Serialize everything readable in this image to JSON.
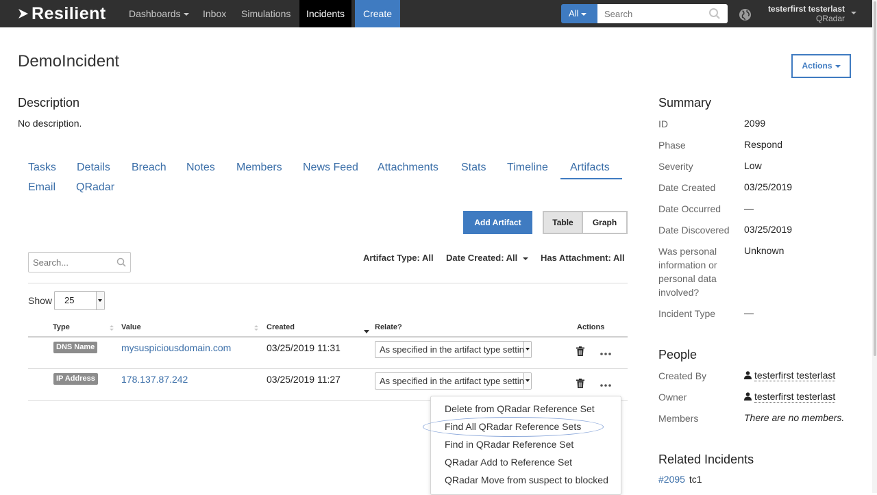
{
  "topnav": {
    "brand": "Resilient",
    "items": [
      {
        "label": "Dashboards"
      },
      {
        "label": "Inbox"
      },
      {
        "label": "Simulations"
      },
      {
        "label": "Incidents"
      },
      {
        "label": "Create"
      }
    ],
    "search_scope": "All",
    "search_placeholder": "Search",
    "user_name": "testerfirst testerlast",
    "user_org": "QRadar"
  },
  "incident": {
    "title": "DemoIncident",
    "actions_label": "Actions",
    "description_heading": "Description",
    "description_text": "No description."
  },
  "tabs": [
    {
      "label": "Tasks"
    },
    {
      "label": "Details"
    },
    {
      "label": "Breach"
    },
    {
      "label": "Notes"
    },
    {
      "label": "Members"
    },
    {
      "label": "News Feed"
    },
    {
      "label": "Attachments"
    },
    {
      "label": "Stats"
    },
    {
      "label": "Timeline"
    },
    {
      "label": "Artifacts"
    },
    {
      "label": "Email"
    },
    {
      "label": "QRadar"
    }
  ],
  "artifacts": {
    "add_label": "Add Artifact",
    "view_table": "Table",
    "view_graph": "Graph",
    "search_placeholder": "Search...",
    "filters": {
      "type": "Artifact Type: All",
      "date": "Date Created: All",
      "attachment": "Has Attachment: All"
    },
    "show_label": "Show",
    "show_value": "25",
    "columns": {
      "type": "Type",
      "value": "Value",
      "created": "Created",
      "relate": "Relate?",
      "actions": "Actions"
    },
    "rows": [
      {
        "type": "DNS Name",
        "value": "mysuspiciousdomain.com",
        "created": "03/25/2019 11:31",
        "relate": "As specified in the artifact type setting"
      },
      {
        "type": "IP Address",
        "value": "178.137.87.242",
        "created": "03/25/2019 11:27",
        "relate": "As specified in the artifact type setting"
      }
    ]
  },
  "context_menu": {
    "items": [
      {
        "label": "Delete from QRadar Reference Set"
      },
      {
        "label": "Find All QRadar Reference Sets"
      },
      {
        "label": "Find in QRadar Reference Set"
      },
      {
        "label": "QRadar Add to Reference Set"
      },
      {
        "label": "QRadar Move from suspect to blocked"
      }
    ],
    "highlighted_item": "Find All QRadar Reference Sets"
  },
  "summary": {
    "heading": "Summary",
    "fields": [
      {
        "label": "ID",
        "value": "2099"
      },
      {
        "label": "Phase",
        "value": "Respond"
      },
      {
        "label": "Severity",
        "value": "Low"
      },
      {
        "label": "Date Created",
        "value": "03/25/2019"
      },
      {
        "label": "Date Occurred",
        "value": "—"
      },
      {
        "label": "Date Discovered",
        "value": "03/25/2019"
      },
      {
        "label": "Was personal information or personal data involved?",
        "value": "Unknown"
      },
      {
        "label": "Incident Type",
        "value": "—"
      }
    ]
  },
  "people": {
    "heading": "People",
    "created_by_label": "Created By",
    "created_by": "testerfirst testerlast",
    "owner_label": "Owner",
    "owner": "testerfirst testerlast",
    "members_label": "Members",
    "members_value": "There are no members."
  },
  "related": {
    "heading": "Related Incidents",
    "items": [
      {
        "number": "#2095",
        "name": "tc1"
      }
    ]
  },
  "colors": {
    "accent": "#3f7bc1",
    "link": "#3a6ea8",
    "topbar": "#303030",
    "badge": "#8c8c8c",
    "highlight_ring": "#8aa7da"
  },
  "icons": [
    "resilient-logo-icon",
    "search-icon",
    "globe-icon",
    "trash-icon",
    "more-icon",
    "person-icon",
    "caret-down-icon"
  ]
}
